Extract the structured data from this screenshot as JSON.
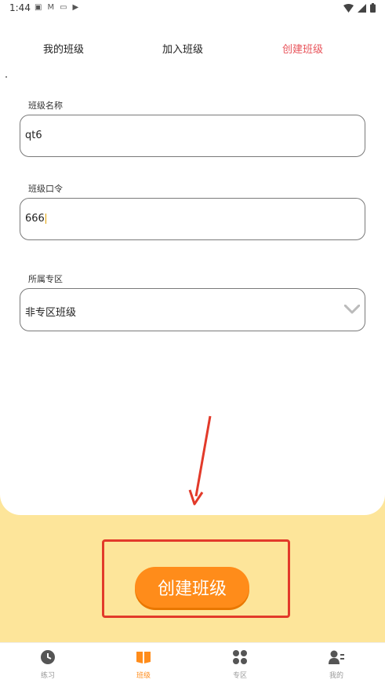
{
  "status_bar": {
    "time": "1:44",
    "icons": [
      "a-icon",
      "gmail-icon",
      "tv-icon",
      "play-icon"
    ],
    "right_icons": [
      "wifi-icon",
      "signal-icon",
      "battery-icon"
    ]
  },
  "tabs": [
    {
      "label": "我的班级",
      "active": false
    },
    {
      "label": "加入班级",
      "active": false
    },
    {
      "label": "创建班级",
      "active": true
    }
  ],
  "form": {
    "class_name": {
      "label": "班级名称",
      "value": "qt6"
    },
    "class_password": {
      "label": "班级口令",
      "value": "666"
    },
    "zone": {
      "label": "所属专区",
      "value": "非专区班级"
    }
  },
  "create_button": {
    "label": "创建班级"
  },
  "bottom_nav": [
    {
      "label": "练习",
      "icon": "clock-icon",
      "active": false
    },
    {
      "label": "班级",
      "icon": "book-icon",
      "active": true
    },
    {
      "label": "专区",
      "icon": "grid-icon",
      "active": false
    },
    {
      "label": "我的",
      "icon": "user-icon",
      "active": false
    }
  ],
  "colors": {
    "accent": "#ff8c1a",
    "active_tab": "#e8545b",
    "background": "#fde59a",
    "annotation": "#e23a2a"
  }
}
